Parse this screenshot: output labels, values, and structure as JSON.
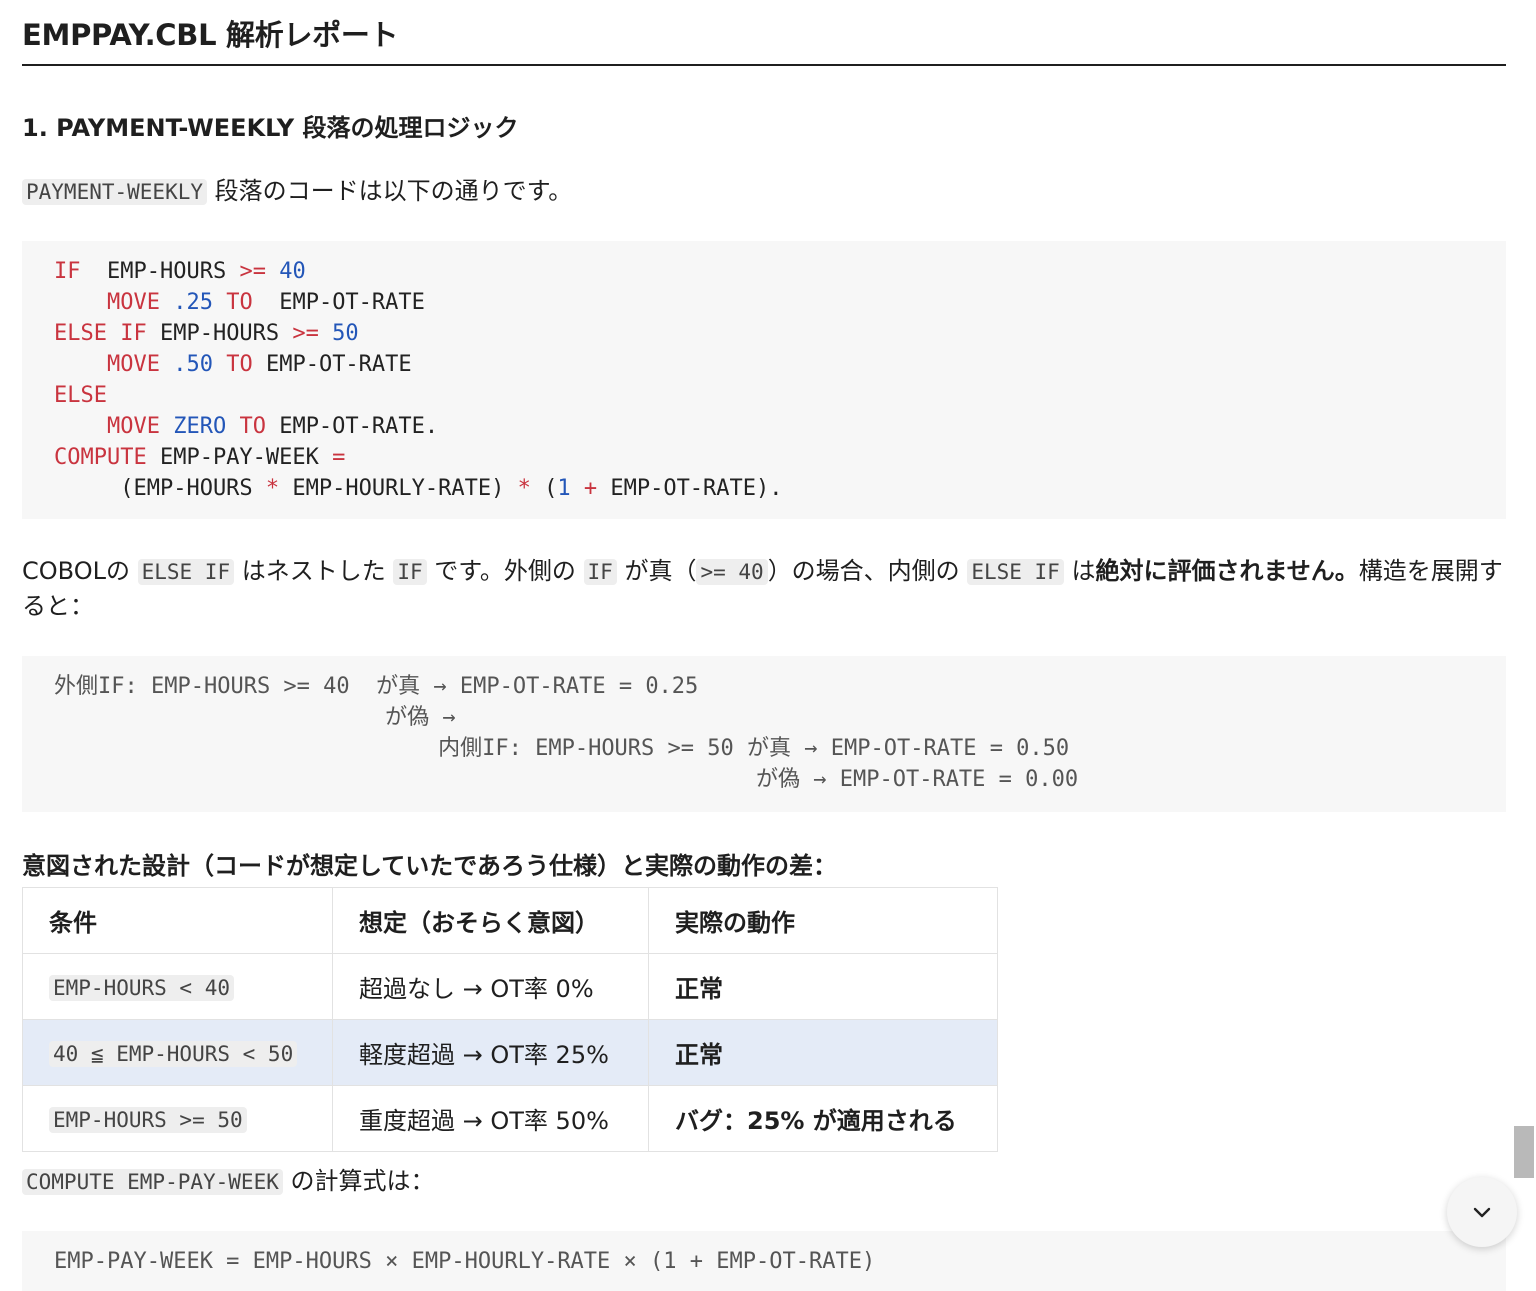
{
  "title": "EMPPAY.CBL 解析レポート",
  "section1": {
    "heading": "1. PAYMENT-WEEKLY 段落の処理ロジック",
    "intro_code": "PAYMENT-WEEKLY",
    "intro_text": " 段落のコードは以下の通りです。"
  },
  "explain": {
    "t1": "COBOLの ",
    "c1": "ELSE IF",
    "t2": " はネストした ",
    "c2": "IF",
    "t3": " です。外側の ",
    "c3": "IF",
    "t4": " が真（",
    "c4": ">= 40",
    "t5": "）の場合、内側の ",
    "c5": "ELSE IF",
    "t6": " は",
    "bold": "絶対に評価されません。",
    "t7": "構造を展開すると："
  },
  "expand_block": {
    "l1": "外側IF: EMP-HOURS >= 40  が真 → EMP-OT-RATE = 0.25",
    "l2": "                         が偽 →",
    "l3": "                             内側IF: EMP-HOURS >= 50 が真 → EMP-OT-RATE = 0.50",
    "l4": "                                                     が偽 → EMP-OT-RATE = 0.00"
  },
  "diff_heading": "意図された設計（コードが想定していたであろう仕様）と実際の動作の差：",
  "table": {
    "headers": [
      "条件",
      "想定（おそらく意図）",
      "実際の動作"
    ],
    "rows": [
      {
        "cond": "EMP-HOURS < 40",
        "expected": "超過なし → OT率 0%",
        "actual": "正常"
      },
      {
        "cond": "40 ≦ EMP-HOURS < 50",
        "expected": "軽度超過 → OT率 25%",
        "actual": "正常"
      },
      {
        "cond": "EMP-HOURS >= 50",
        "expected": "重度超過 → OT率 50%",
        "actual": "バグ：25% が適用される"
      }
    ]
  },
  "compute_intro": {
    "code": "COMPUTE EMP-PAY-WEEK",
    "text": " の計算式は："
  },
  "formula": "EMP-PAY-WEEK = EMP-HOURS × EMP-HOURLY-RATE × (1 + EMP-OT-RATE)",
  "icons": {
    "scroll_down": "chevron-down-icon"
  }
}
